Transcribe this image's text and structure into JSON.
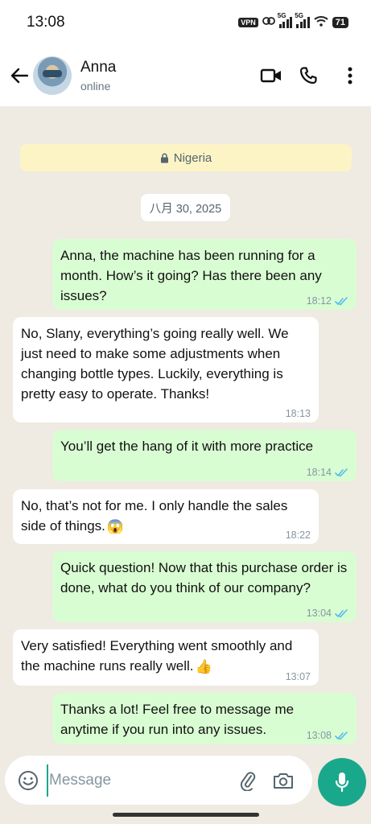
{
  "status_bar": {
    "time": "13:08",
    "vpn": "VPN",
    "net1": "5G",
    "net2": "5G",
    "battery": "71"
  },
  "header": {
    "name": "Anna",
    "status": "online"
  },
  "chat": {
    "banner": "Nigeria",
    "date": "八月 30, 2025",
    "messages": [
      {
        "dir": "out",
        "text": "Anna, the machine has been running for a month. How’s it going? Has there been any issues?",
        "time": "18:12"
      },
      {
        "dir": "in",
        "text": "No, Slany, everything’s going really well. We just need to make some adjustments when changing bottle types. Luckily, everything is pretty easy to operate. Thanks!",
        "time": "18:13"
      },
      {
        "dir": "out",
        "text": "You’ll get the hang of it with more practice",
        "time": "18:14"
      },
      {
        "dir": "in",
        "text": "No, that’s not for me. I only handle the sales side of things.",
        "emoji": "😱",
        "time": "18:22"
      },
      {
        "dir": "out",
        "text": "Quick question! Now that this purchase order is done, what do you think of our company?",
        "time": "13:04"
      },
      {
        "dir": "in",
        "text": "Very satisfied! Everything went smoothly and the machine runs really well.",
        "emoji": "👍",
        "time": "13:07"
      },
      {
        "dir": "out",
        "text": "Thanks a lot! Feel free to message me anytime if you run into any issues.",
        "time": "13:08"
      }
    ]
  },
  "composer": {
    "placeholder": "Message"
  },
  "colors": {
    "outgoing_bubble": "#d9fdd3",
    "incoming_bubble": "#ffffff",
    "chat_background": "#efeae2",
    "accent": "#1aa88d",
    "read_ticks": "#53bdeb"
  }
}
